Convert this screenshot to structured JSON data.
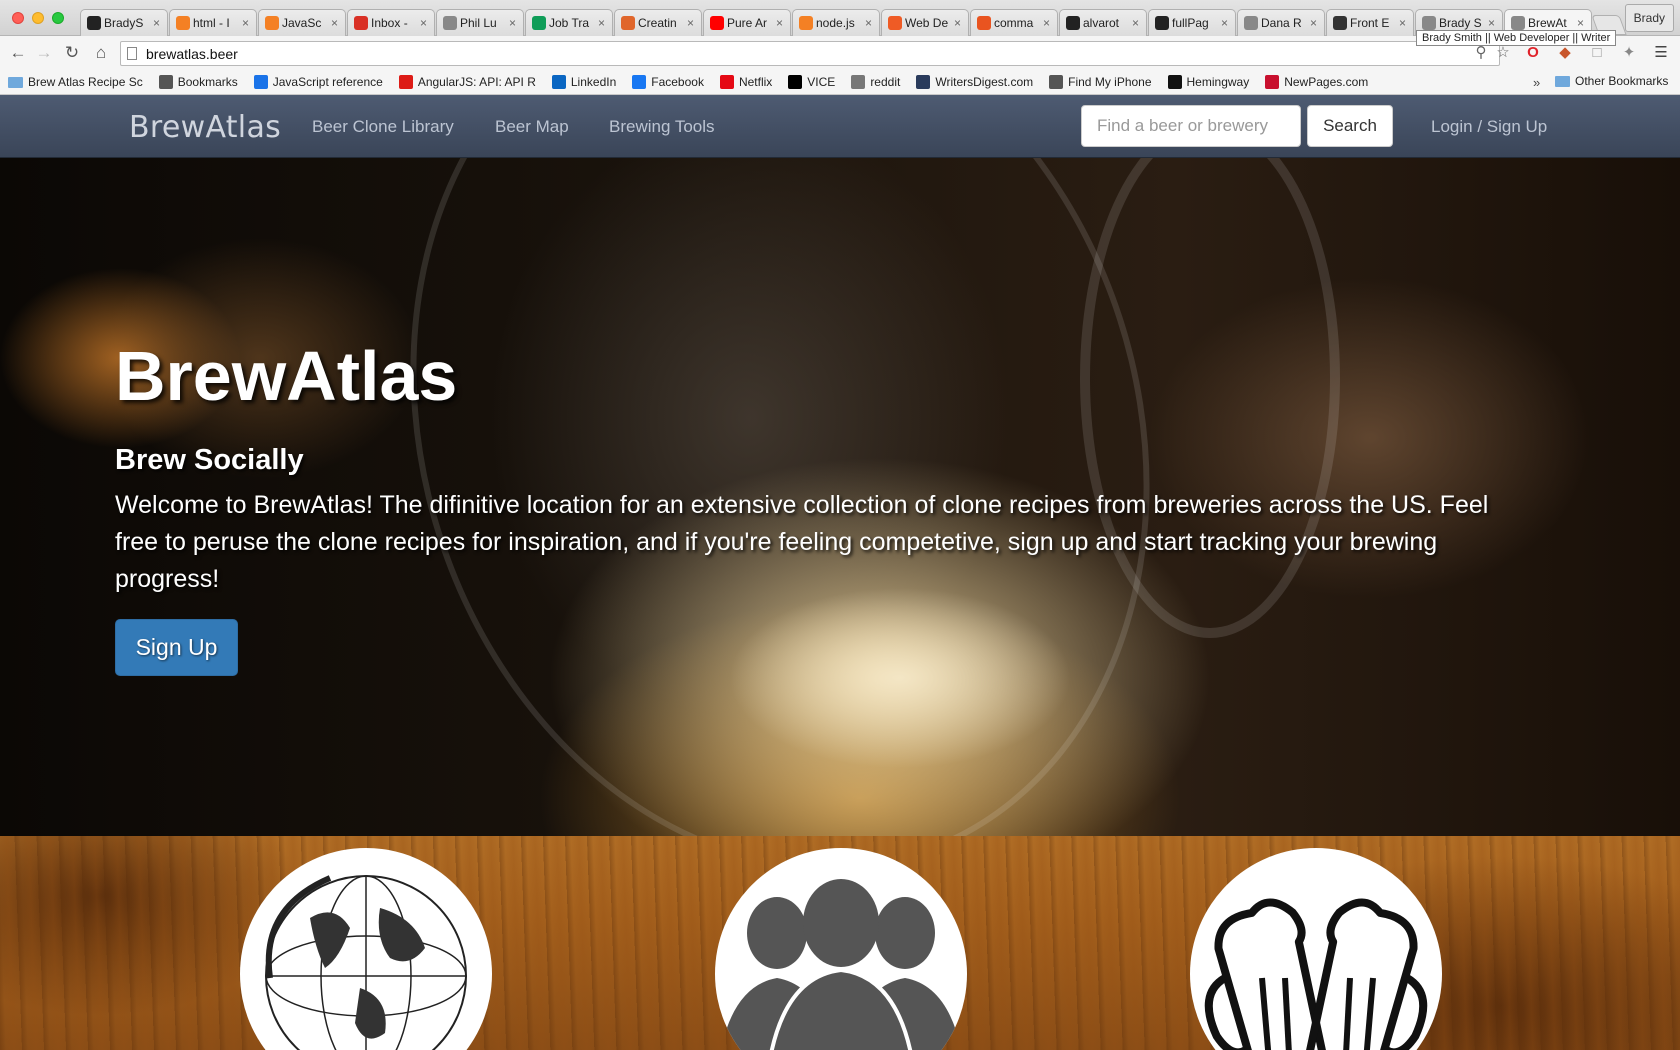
{
  "browser": {
    "tabs": [
      {
        "title": "BradyS",
        "icon": "github-icon",
        "color": "#222222"
      },
      {
        "title": "html - I",
        "icon": "stackoverflow-icon",
        "color": "#f48024"
      },
      {
        "title": "JavaSc",
        "icon": "stackoverflow-icon",
        "color": "#f48024"
      },
      {
        "title": "Inbox -",
        "icon": "gmail-icon",
        "color": "#d93025"
      },
      {
        "title": "Phil Lu",
        "icon": "page-icon",
        "color": "#888888"
      },
      {
        "title": "Job Tra",
        "icon": "sheets-icon",
        "color": "#0f9d58"
      },
      {
        "title": "Creatin",
        "icon": "codeschool-icon",
        "color": "#e0662b"
      },
      {
        "title": "Pure Ar",
        "icon": "youtube-icon",
        "color": "#ff0000"
      },
      {
        "title": "node.js",
        "icon": "stackoverflow-icon",
        "color": "#f48024"
      },
      {
        "title": "Web De",
        "icon": "dots-icon",
        "color": "#ef5b25"
      },
      {
        "title": "comma",
        "icon": "askubuntu-icon",
        "color": "#e95420"
      },
      {
        "title": "alvarot",
        "icon": "github-icon",
        "color": "#222222"
      },
      {
        "title": "fullPag",
        "icon": "github-icon",
        "color": "#222222"
      },
      {
        "title": "Dana R",
        "icon": "page-icon",
        "color": "#888888"
      },
      {
        "title": "Front E",
        "icon": "fem-icon",
        "color": "#333333"
      },
      {
        "title": "Brady S",
        "icon": "page-icon",
        "color": "#888888"
      },
      {
        "title": "BrewAt",
        "icon": "page-icon",
        "color": "#888888",
        "active": true
      }
    ],
    "profile_name": "Brady",
    "tooltip": "Brady Smith || Web Developer || Writer",
    "url": "brewatlas.beer",
    "bookmarks": [
      {
        "label": "Brew Atlas Recipe Sc",
        "icon": "folder-icon",
        "color": "#6fa8dc"
      },
      {
        "label": "Bookmarks",
        "icon": "star-icon",
        "color": "#555555"
      },
      {
        "label": "JavaScript reference",
        "icon": "mdn-icon",
        "color": "#1a73e8"
      },
      {
        "label": "AngularJS: API: API R",
        "icon": "angular-icon",
        "color": "#dd1b16"
      },
      {
        "label": "LinkedIn",
        "icon": "linkedin-icon",
        "color": "#0a66c2"
      },
      {
        "label": "Facebook",
        "icon": "facebook-icon",
        "color": "#1877f2"
      },
      {
        "label": "Netflix",
        "icon": "netflix-icon",
        "color": "#e50914"
      },
      {
        "label": "VICE",
        "icon": "vice-icon",
        "color": "#000000"
      },
      {
        "label": "reddit",
        "icon": "reddit-icon",
        "color": "#777777"
      },
      {
        "label": "WritersDigest.com",
        "icon": "wd-icon",
        "color": "#2a3b5c"
      },
      {
        "label": "Find My iPhone",
        "icon": "apple-icon",
        "color": "#555555"
      },
      {
        "label": "Hemingway",
        "icon": "hemingway-icon",
        "color": "#111111"
      },
      {
        "label": "NewPages.com",
        "icon": "newpages-icon",
        "color": "#c8102e"
      }
    ],
    "bookmarks_more": "»",
    "other_bookmarks": "Other Bookmarks"
  },
  "site": {
    "brand": "BrewAtlas",
    "nav": [
      "Beer Clone Library",
      "Beer Map",
      "Brewing Tools"
    ],
    "search_placeholder": "Find a beer or brewery",
    "search_button": "Search",
    "login": "Login / Sign Up",
    "hero": {
      "title": "BrewAtlas",
      "subtitle": "Brew Socially",
      "text": "Welcome to BrewAtlas! The difinitive location for an extensive collection of clone recipes from breweries across the US. Feel free to peruse the clone recipes for inspiration, and if you're feeling competetive, sign up and start tracking your brewing progress!",
      "cta": "Sign Up"
    },
    "features": [
      {
        "icon": "globe-icon"
      },
      {
        "icon": "people-icon"
      },
      {
        "icon": "beer-mugs-icon"
      }
    ]
  }
}
